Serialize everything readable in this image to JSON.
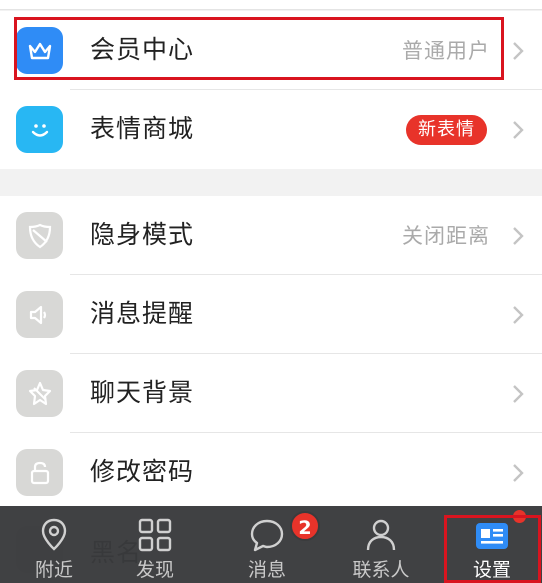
{
  "colors": {
    "vip_icon": "#2f8cf6",
    "sticker_icon": "#28b7f3",
    "gray_icon": "#d8d8d6",
    "badge_red": "#e8332a",
    "highlight": "#d9141f",
    "tabbar": "#3a3b3d"
  },
  "menu": {
    "vip": {
      "label": "会员中心",
      "value": "普通用户",
      "icon": "crown-icon"
    },
    "stickers": {
      "label": "表情商城",
      "badge": "新表情",
      "icon": "smile-icon"
    },
    "stealth": {
      "label": "隐身模式",
      "value": "关闭距离",
      "icon": "shield-slash-icon"
    },
    "notify": {
      "label": "消息提醒",
      "icon": "speaker-icon"
    },
    "chat_bg": {
      "label": "聊天背景",
      "icon": "star-icon"
    },
    "password": {
      "label": "修改密码",
      "icon": "lock-icon"
    },
    "blacklist": {
      "label": "黑名"
    }
  },
  "tabbar": {
    "nearby": {
      "label": "附近",
      "icon": "location-pin-icon"
    },
    "discover": {
      "label": "发现",
      "icon": "grid-icon"
    },
    "messages": {
      "label": "消息",
      "icon": "chat-bubble-icon",
      "badge": "2"
    },
    "contacts": {
      "label": "联系人",
      "icon": "person-icon"
    },
    "settings": {
      "label": "设置",
      "icon": "settings-card-icon"
    }
  }
}
